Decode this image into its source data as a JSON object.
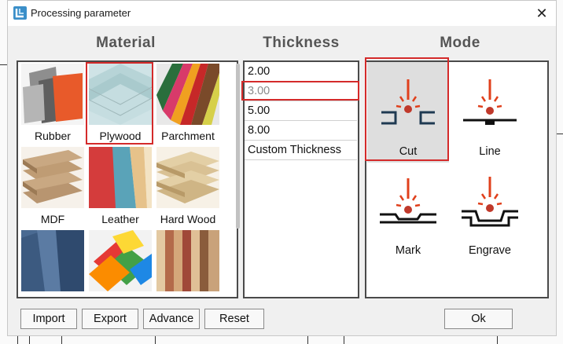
{
  "window": {
    "title": "Processing parameter",
    "close_symbol": "✕"
  },
  "headers": {
    "material": "Material",
    "thickness": "Thickness",
    "mode": "Mode"
  },
  "materials": [
    {
      "label": "Rubber",
      "selected": false
    },
    {
      "label": "Plywood",
      "selected": true
    },
    {
      "label": "Parchment",
      "selected": false
    },
    {
      "label": "MDF",
      "selected": false
    },
    {
      "label": "Leather",
      "selected": false
    },
    {
      "label": "Hard Wood",
      "selected": false
    },
    {
      "label": "",
      "selected": false
    },
    {
      "label": "",
      "selected": false
    },
    {
      "label": "",
      "selected": false
    }
  ],
  "thickness": {
    "items": [
      "2.00",
      "3.00",
      "5.00",
      "8.00",
      "Custom Thickness"
    ],
    "selected": "3.00"
  },
  "modes": [
    {
      "label": "Cut",
      "icon": "laser-cut-icon",
      "selected": true
    },
    {
      "label": "Line",
      "icon": "laser-line-icon",
      "selected": false
    },
    {
      "label": "Mark",
      "icon": "laser-mark-icon",
      "selected": false
    },
    {
      "label": "Engrave",
      "icon": "laser-engrave-icon",
      "selected": false
    }
  ],
  "buttons": {
    "import": "Import",
    "export": "Export",
    "advance": "Advance",
    "reset": "Reset",
    "ok": "Ok"
  },
  "colors": {
    "selection_red": "#d42a2a",
    "laser_red": "#e0401c",
    "dark_blue": "#1f3a52"
  }
}
